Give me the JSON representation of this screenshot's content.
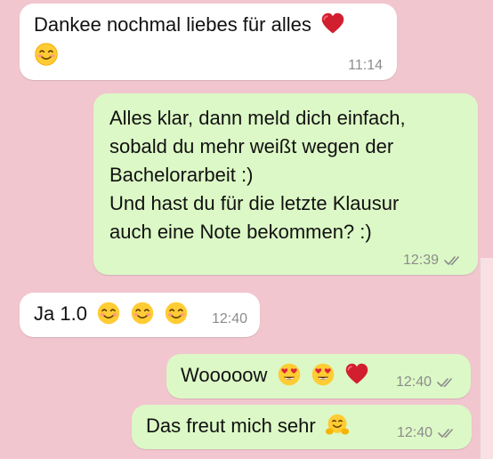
{
  "messages": [
    {
      "id": "b1",
      "direction": "incoming",
      "text": "Dankee nochmal liebes für alles",
      "time": "11:14",
      "emojis": [
        "heart-icon",
        "smiling-face-icon"
      ]
    },
    {
      "id": "b2",
      "direction": "outgoing",
      "text": "Alles klar, dann meld dich einfach,\nsobald du mehr weißt wegen der\nBachelorarbeit :)\nUnd hast du für die letzte Klausur\nauch eine Note bekommen? :)",
      "time": "12:39",
      "ticks": "read-ticks-icon"
    },
    {
      "id": "b3",
      "direction": "incoming",
      "text": "Ja 1.0",
      "time": "12:40",
      "emojis": [
        "smiling-face-icon",
        "smiling-face-icon",
        "smiling-face-icon"
      ]
    },
    {
      "id": "b4",
      "direction": "outgoing",
      "text": "Wooooow",
      "time": "12:40",
      "emojis": [
        "heart-eyes-icon",
        "heart-eyes-icon",
        "heart-icon"
      ],
      "ticks": "read-ticks-icon"
    },
    {
      "id": "b5",
      "direction": "outgoing",
      "text": "Das freut mich sehr",
      "time": "12:40",
      "emojis": [
        "hugging-face-icon"
      ],
      "ticks": "read-ticks-icon"
    }
  ],
  "colors": {
    "background": "#f2c6cf",
    "incoming_bubble": "#ffffff",
    "outgoing_bubble": "#dcf8c6",
    "meta_text": "#8c8c8c"
  }
}
